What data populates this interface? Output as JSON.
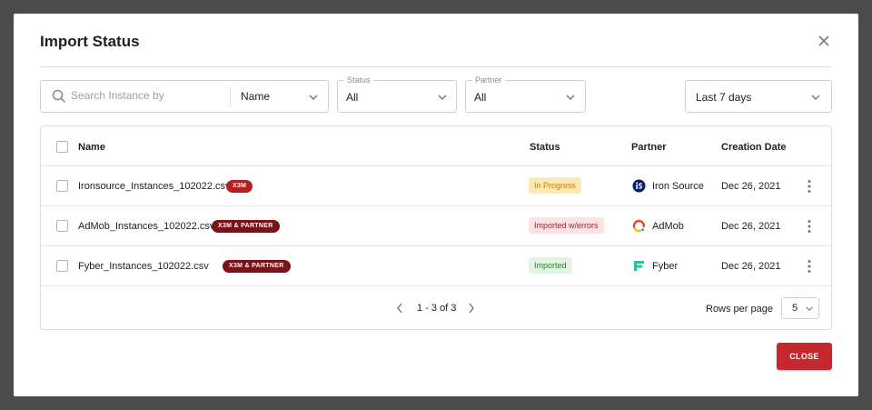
{
  "dialog": {
    "title": "Import Status",
    "close_icon": "close-icon"
  },
  "filters": {
    "search": {
      "placeholder": "Search Instance by",
      "value": "",
      "icon": "search-icon"
    },
    "search_by": {
      "value": "Name"
    },
    "status": {
      "label": "Status",
      "value": "All"
    },
    "partner": {
      "label": "Partner",
      "value": "All"
    },
    "date_range": {
      "value": "Last 7 days"
    }
  },
  "table": {
    "headers": {
      "name": "Name",
      "status": "Status",
      "partner": "Partner",
      "date": "Creation Date"
    },
    "rows": [
      {
        "name": "Ironsource_Instances_102022.csv",
        "tag": "X3M",
        "status": "In Progress",
        "partner": "Iron Source",
        "partner_icon": "ironsource-logo-icon",
        "date": "Dec 26, 2021"
      },
      {
        "name": "AdMob_Instances_102022.csv",
        "tag": "X3M & PARTNER",
        "status": "Imported w/errors",
        "partner": "AdMob",
        "partner_icon": "admob-logo-icon",
        "date": "Dec 26, 2021"
      },
      {
        "name": "Fyber_Instances_102022.csv",
        "tag": "X3M & PARTNER",
        "status": "Imported",
        "partner": "Fyber",
        "partner_icon": "fyber-logo-icon",
        "date": "Dec 26, 2021"
      }
    ]
  },
  "pagination": {
    "range": "1 - 3 of 3",
    "rows_per_page_label": "Rows per page",
    "rows_per_page": "5"
  },
  "footer": {
    "close_label": "CLOSE"
  },
  "colors": {
    "overlay": "#4b4b4b",
    "primary_red": "#c4282d",
    "tag_red": "#b51f24",
    "tag_dark_red": "#7a1217",
    "in_progress_bg": "#fde9b4",
    "errors_bg": "#fbe3e3",
    "imported_bg": "#e2f4e2"
  }
}
